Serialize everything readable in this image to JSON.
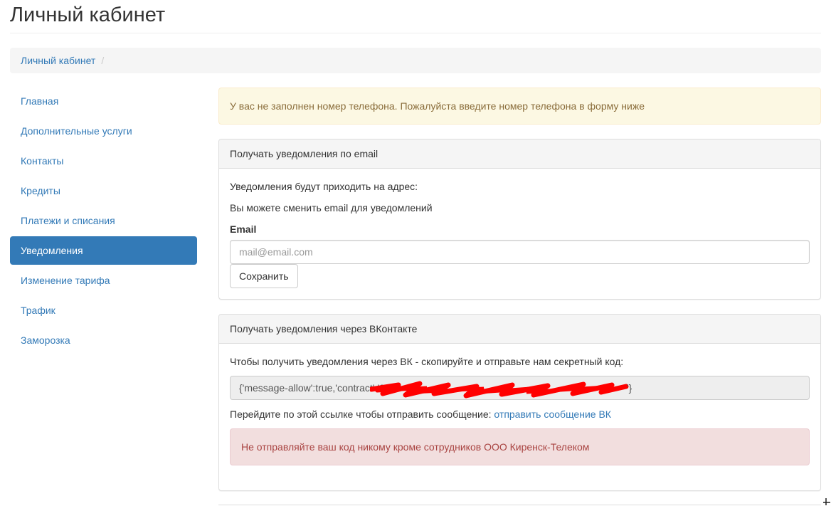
{
  "page": {
    "title": "Личный кабинет"
  },
  "breadcrumb": {
    "items": [
      "Личный кабинет"
    ],
    "separator": "/"
  },
  "sidebar": {
    "items": [
      {
        "label": "Главная",
        "active": false
      },
      {
        "label": "Дополнительные услуги",
        "active": false
      },
      {
        "label": "Контакты",
        "active": false
      },
      {
        "label": "Кредиты",
        "active": false
      },
      {
        "label": "Платежи и списания",
        "active": false
      },
      {
        "label": "Уведомления",
        "active": true
      },
      {
        "label": "Изменение тарифа",
        "active": false
      },
      {
        "label": "Трафик",
        "active": false
      },
      {
        "label": "Заморозка",
        "active": false
      }
    ]
  },
  "alerts": {
    "phone_warning": "У вас не заполнен номер телефона. Пожалуйста введите номер телефона в форму ниже"
  },
  "email_panel": {
    "heading": "Получать уведомления по email",
    "address_text": "Уведомления будут приходить на адрес:",
    "change_text": "Вы можете сменить email для уведомлений",
    "field_label": "Email",
    "input_value": "",
    "input_placeholder": "mail@email.com",
    "save_button": "Сохранить"
  },
  "vk_panel": {
    "heading": "Получать уведомления через ВКонтакте",
    "instruction": "Чтобы получить уведомления через ВК - скопируйте и отправьте нам секретный код:",
    "code_prefix": "{'message-allow':true,'contract':'0",
    "code_suffix": "'}",
    "link_prefix": "Перейдите по этой ссылке чтобы отправить сообщение:",
    "link_text": "отправить сообщение ВК",
    "danger_text": "Не отправляйте ваш код никому кроме сотрудников ООО Киренск-Телеком"
  },
  "colors": {
    "accent": "#337ab7",
    "warning_bg": "#fcf8e3",
    "warning_text": "#8a6d3b",
    "danger_bg": "#f2dede",
    "danger_text": "#a94442",
    "redaction": "#ff0000"
  },
  "icons": {
    "redaction": "scribble-redaction-icon",
    "resize": "resize-handle-icon"
  }
}
